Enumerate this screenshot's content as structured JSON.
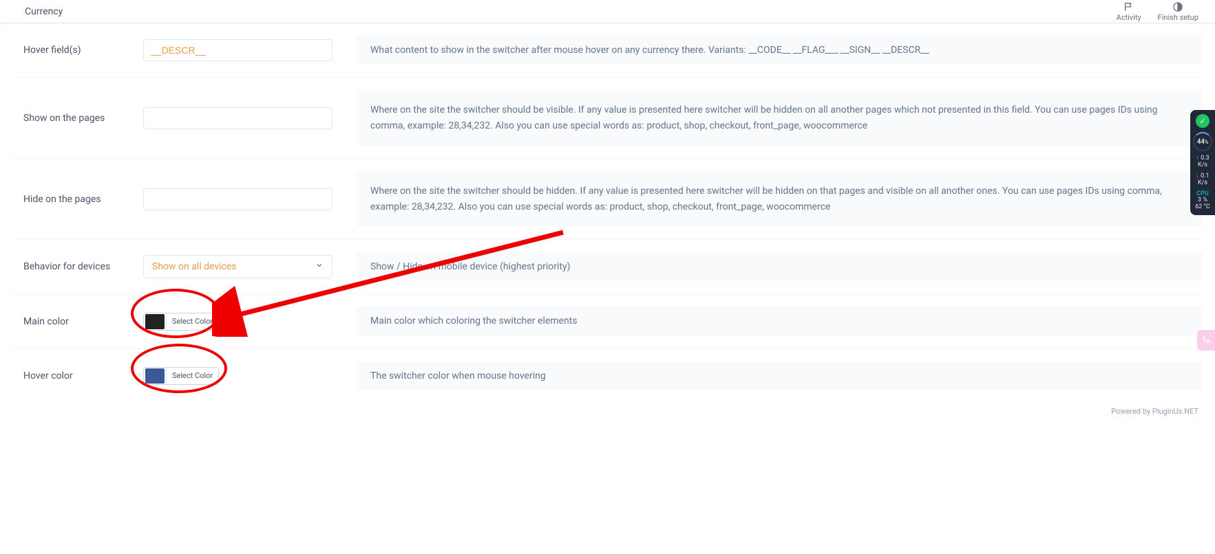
{
  "topbar": {
    "title": "Currency",
    "activity": "Activity",
    "finish_setup": "Finish setup"
  },
  "rows": {
    "hover_fields": {
      "label": "Hover field(s)",
      "value": "__DESCR__",
      "desc": "What content to show in the switcher after mouse hover on any currency there. Variants: __CODE__ __FLAG___ __SIGN__ __DESCR__"
    },
    "show_pages": {
      "label": "Show on the pages",
      "value": "",
      "desc": "Where on the site the switcher should be visible. If any value is presented here switcher will be hidden on all another pages which not presented in this field. You can use pages IDs using comma, example: 28,34,232. Also you can use special words as: product, shop, checkout, front_page, woocommerce"
    },
    "hide_pages": {
      "label": "Hide on the pages",
      "value": "",
      "desc": "Where on the site the switcher should be hidden. If any value is presented here switcher will be hidden on that pages and visible on all another ones. You can use pages IDs using comma, example: 28,34,232. Also you can use special words as: product, shop, checkout, front_page, woocommerce"
    },
    "behavior": {
      "label": "Behavior for devices",
      "selected": "Show on all devices",
      "desc": "Show / Hide on mobile device (highest priority)"
    },
    "main_color": {
      "label": "Main color",
      "button": "Select Color",
      "swatch": "#222222",
      "desc": "Main color which coloring the switcher elements"
    },
    "hover_color": {
      "label": "Hover color",
      "button": "Select Color",
      "swatch": "#3b5998",
      "desc": "The switcher color when mouse hovering"
    }
  },
  "footer": {
    "text": "Powered by PluginUs.NET"
  },
  "sysmon": {
    "gauge": "44",
    "gauge_suffix": "%",
    "up_speed": "0.3",
    "up_unit": "K/s",
    "down_speed": "0.1",
    "down_unit": "K/s",
    "cpu_label": "CPU",
    "cpu_pct": "3  %",
    "temp": "62 °C"
  },
  "colors": {
    "highlight": "#ef0000"
  }
}
